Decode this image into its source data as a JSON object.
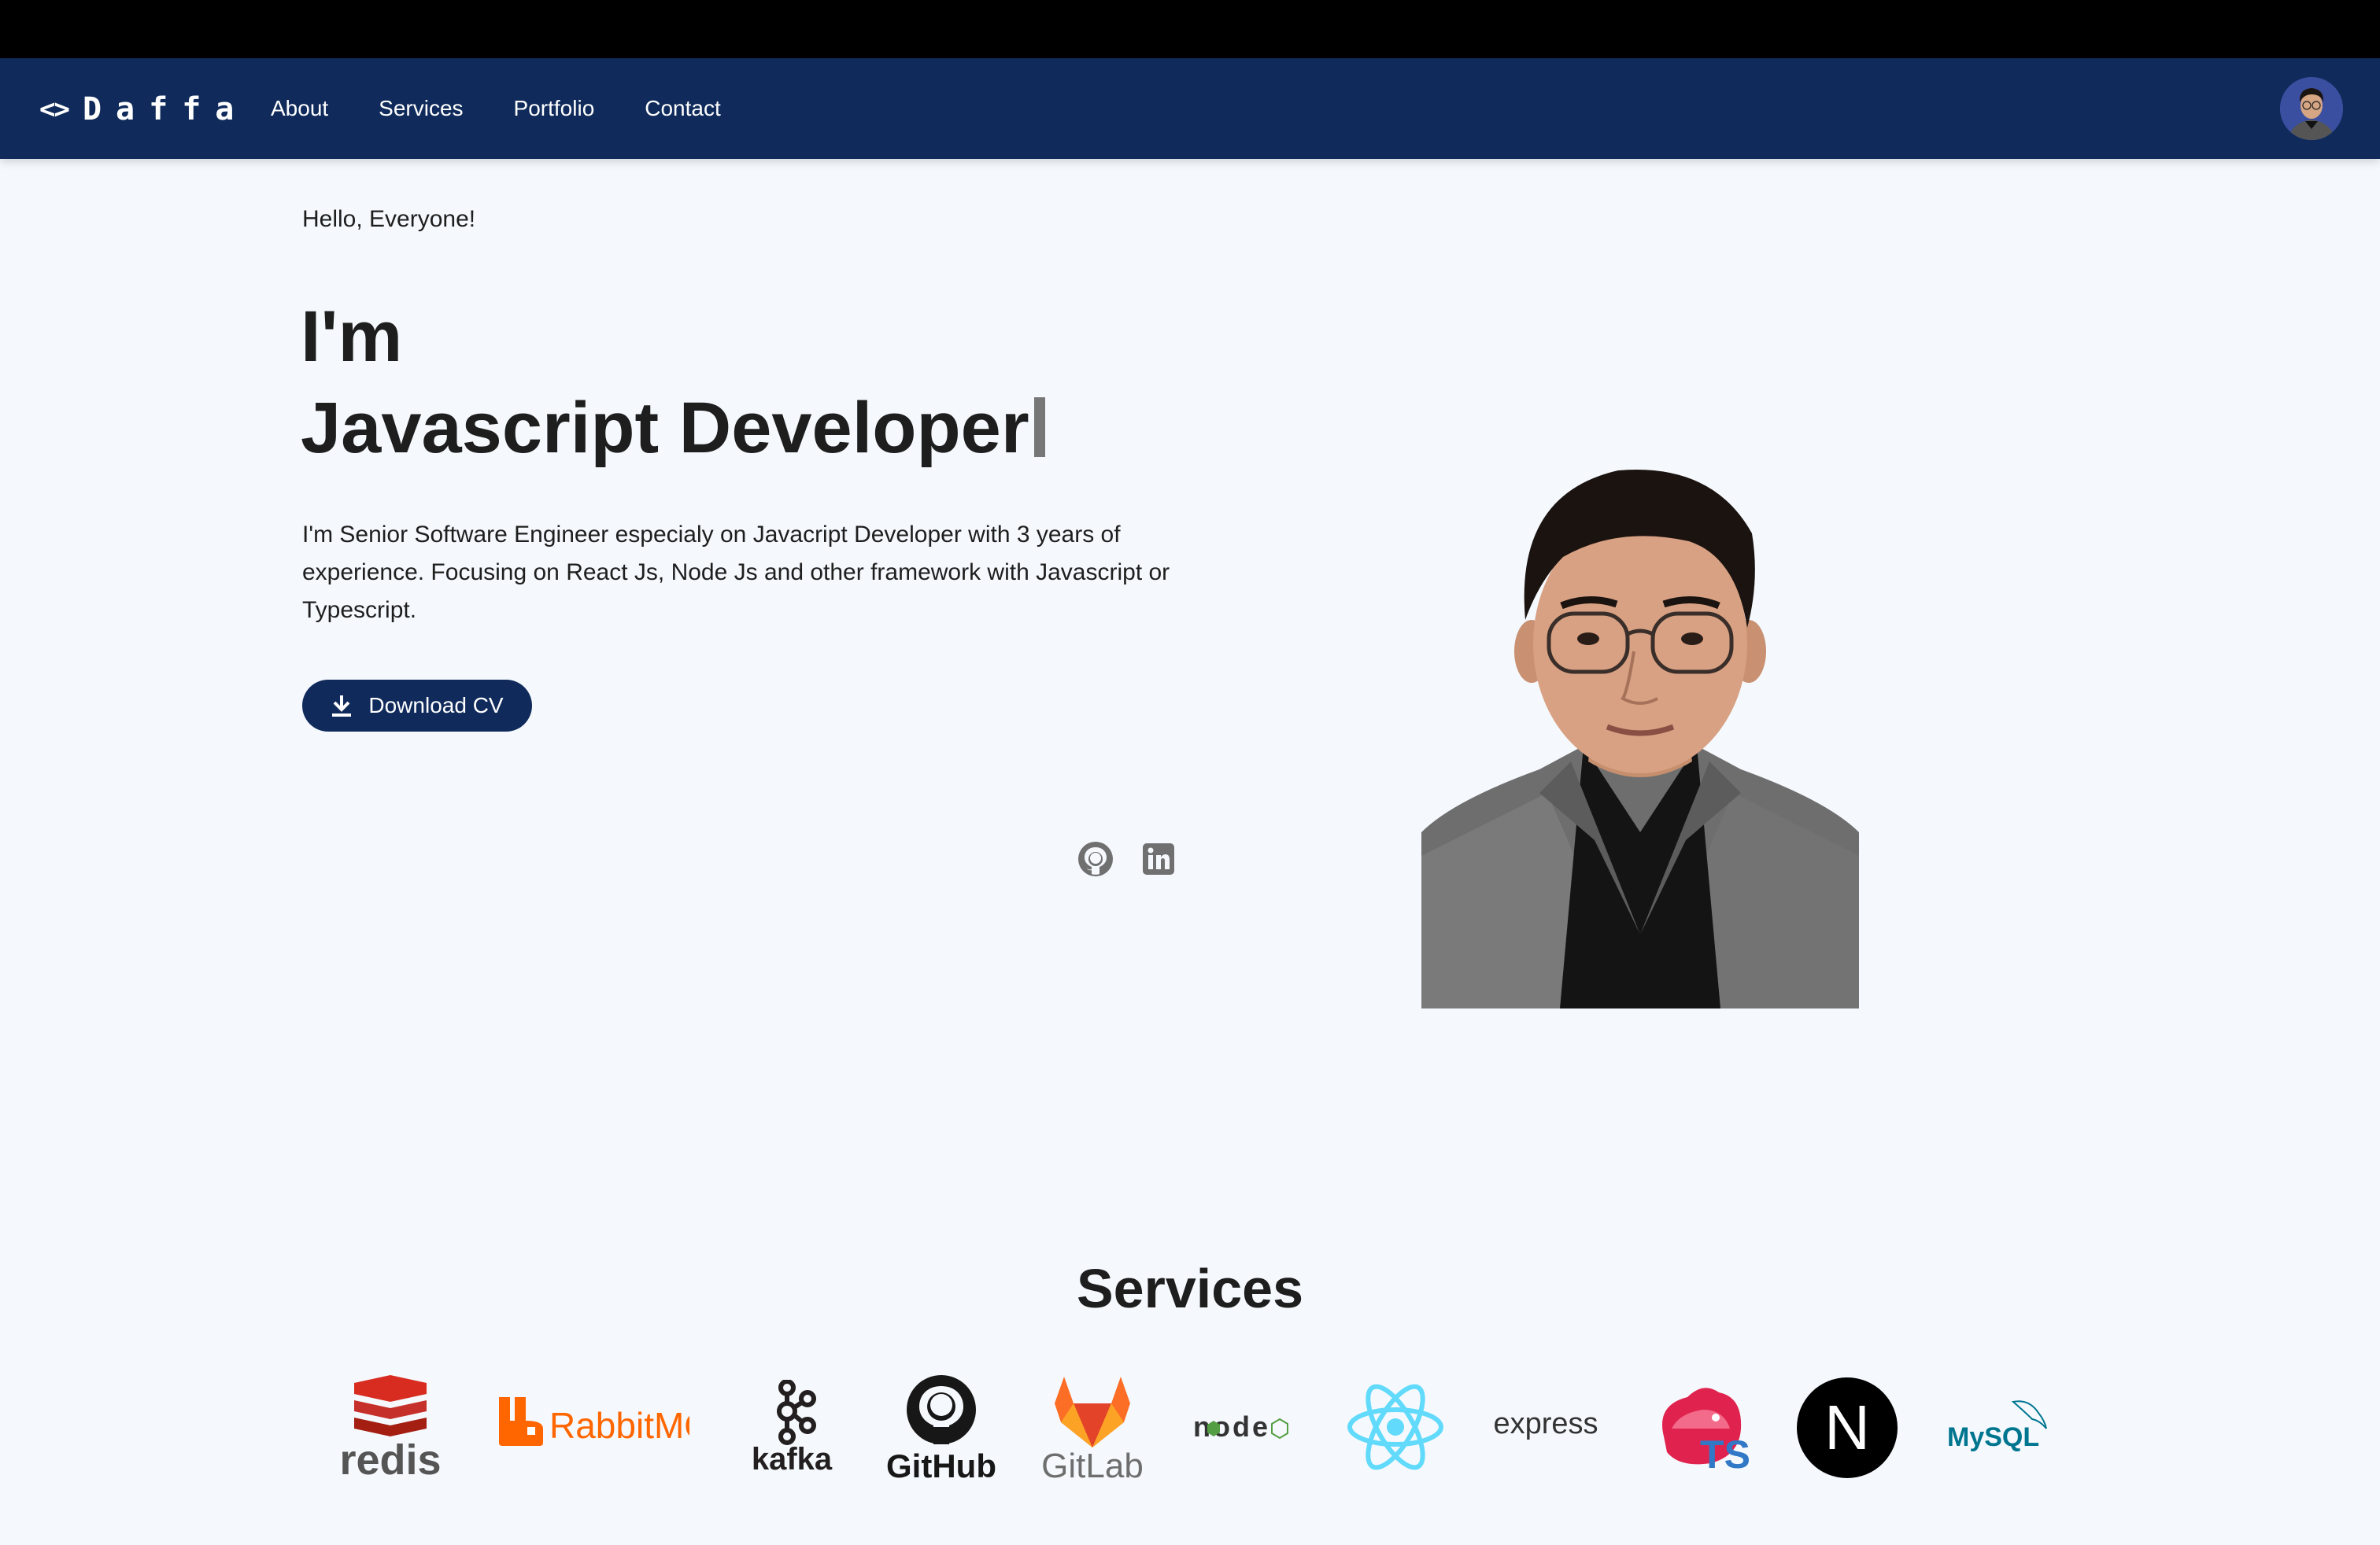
{
  "brand": {
    "icon": "code-brackets-icon",
    "icon_text": "<>",
    "name": "Daffa"
  },
  "nav": {
    "links": [
      "About",
      "Services",
      "Portfolio",
      "Contact"
    ],
    "avatar": "avatar"
  },
  "hero": {
    "greeting": "Hello, Everyone!",
    "line1": "I'm",
    "line2": "Javascript Developer",
    "bio": "I'm Senior Software Engineer especialy on Javacript Developer with 3 years of experience. Focusing on React Js, Node Js and other framework with Javascript or Typescript.",
    "download_label": "Download CV",
    "download_icon": "download-icon",
    "social": [
      "github-icon",
      "linkedin-icon"
    ]
  },
  "services": {
    "title": "Services",
    "logos": [
      {
        "name": "redis",
        "label": "redis",
        "color": "#d82c20"
      },
      {
        "name": "rabbitmq",
        "label": "RabbitMQ",
        "color": "#ff6600"
      },
      {
        "name": "kafka",
        "label": "kafka",
        "color": "#231f20"
      },
      {
        "name": "github",
        "label": "GitHub",
        "color": "#181717"
      },
      {
        "name": "gitlab",
        "label": "GitLab",
        "color": "#fc6d26"
      },
      {
        "name": "node",
        "label": "node",
        "color": "#539e43"
      },
      {
        "name": "react",
        "label": "",
        "color": "#61dafb"
      },
      {
        "name": "express",
        "label": "express",
        "color": "#333333"
      },
      {
        "name": "nestjs-ts",
        "label": "TS",
        "color": "#e0234e"
      },
      {
        "name": "nextjs",
        "label": "N",
        "color": "#000000"
      },
      {
        "name": "mysql",
        "label": "MySQL",
        "color": "#00758f"
      }
    ]
  },
  "colors": {
    "nav_bg": "#102b5b",
    "page_bg": "#f5f9fd",
    "text": "#1e1e1e"
  }
}
